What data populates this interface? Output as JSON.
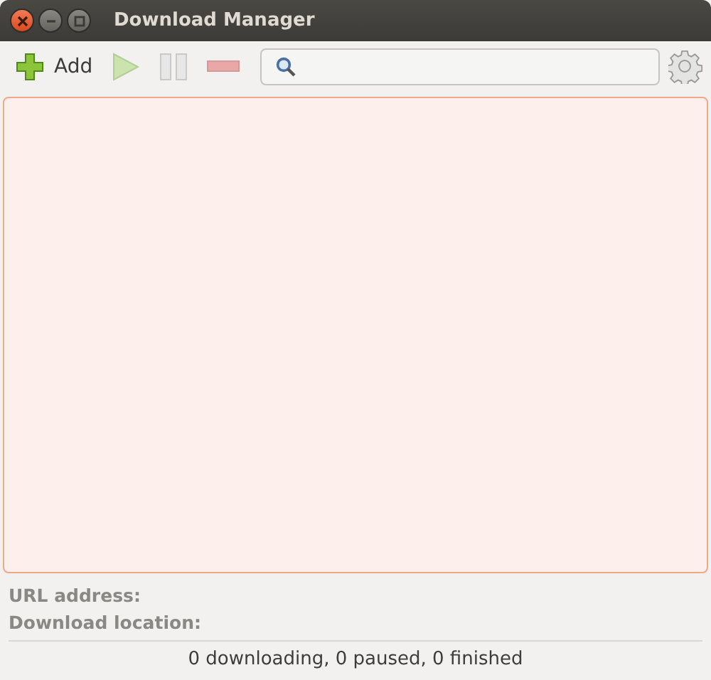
{
  "window": {
    "title": "Download Manager"
  },
  "toolbar": [
    {
      "kind": "add",
      "label": "Add",
      "disabled": false
    },
    {
      "kind": "play",
      "disabled": true
    },
    {
      "kind": "pause",
      "disabled": true
    },
    {
      "kind": "remove",
      "disabled": true
    }
  ],
  "details": [
    "URL address:",
    "Download location:"
  ],
  "status_bar": "0 downloading, 0 paused, 0 finished"
}
